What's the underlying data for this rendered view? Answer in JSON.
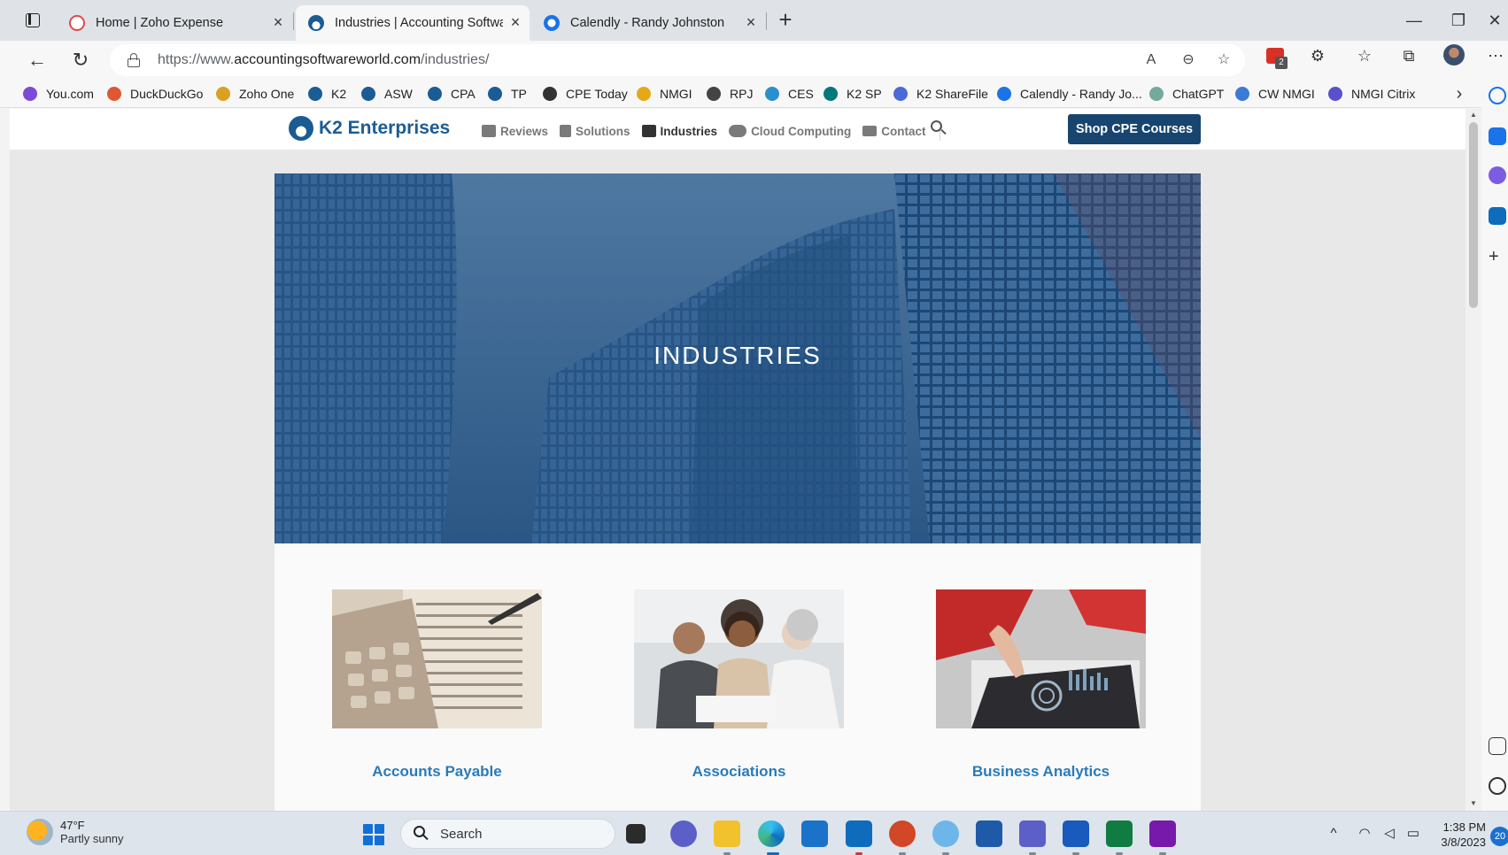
{
  "browser": {
    "tabs": [
      {
        "title": "Home | Zoho Expense",
        "favicon": "zoho-expense-icon",
        "active": false
      },
      {
        "title": "Industries | Accounting Software",
        "favicon": "asw-icon",
        "active": true
      },
      {
        "title": "Calendly - Randy Johnston",
        "favicon": "calendly-icon",
        "active": false
      }
    ],
    "close_glyph": "×",
    "new_tab_glyph": "+",
    "window": {
      "minimize": "—",
      "restore": "❐",
      "close": "✕"
    },
    "url_prefix": "https://www.",
    "url_host": "accountingsoftwareworld.com",
    "url_path": "/industries/",
    "toolbar_badge": "2",
    "bookmarks": [
      {
        "label": "You.com",
        "color": "#7a4bd8"
      },
      {
        "label": "DuckDuckGo",
        "color": "#de5833"
      },
      {
        "label": "Zoho One",
        "color": "#d9a021"
      },
      {
        "label": "K2",
        "color": "#1b5c95"
      },
      {
        "label": "ASW",
        "color": "#1b5c95"
      },
      {
        "label": "CPA",
        "color": "#1b5c95"
      },
      {
        "label": "TP",
        "color": "#1b5c95"
      },
      {
        "label": "CPE Today",
        "color": "#333333"
      },
      {
        "label": "NMGI",
        "color": "#e6a817"
      },
      {
        "label": "RPJ",
        "color": "#444444"
      },
      {
        "label": "CES",
        "color": "#2a8fd1"
      },
      {
        "label": "K2 SP",
        "color": "#03787c"
      },
      {
        "label": "K2 ShareFile",
        "color": "#4b6ad8"
      },
      {
        "label": "Calendly - Randy Jo...",
        "color": "#1a73e8"
      },
      {
        "label": "ChatGPT",
        "color": "#74aa9c"
      },
      {
        "label": "CW NMGI",
        "color": "#3a7bd5"
      },
      {
        "label": "NMGI Citrix",
        "color": "#5a4fcf"
      }
    ]
  },
  "site": {
    "brand": "K2 Enterprises",
    "nav": [
      {
        "label": "Reviews",
        "icon": "list-icon",
        "current": false
      },
      {
        "label": "Solutions",
        "icon": "calculator-icon",
        "current": false
      },
      {
        "label": "Industries",
        "icon": "factory-icon",
        "current": true
      },
      {
        "label": "Cloud Computing",
        "icon": "cloud-icon",
        "current": false
      },
      {
        "label": "Contact",
        "icon": "envelope-icon",
        "current": false
      }
    ],
    "cta": "Shop CPE Courses",
    "hero_title": "INDUSTRIES",
    "cards": [
      {
        "label": "Accounts Payable"
      },
      {
        "label": "Associations"
      },
      {
        "label": "Business Analytics"
      }
    ]
  },
  "taskbar": {
    "temperature": "47°F",
    "condition": "Partly sunny",
    "search_label": "Search",
    "time": "1:38 PM",
    "date": "3/8/2023",
    "notification_count": "20"
  },
  "colors": {
    "brand_blue": "#1b5c95",
    "cta_bg": "#17456f",
    "card_title": "#2a7bb8"
  }
}
